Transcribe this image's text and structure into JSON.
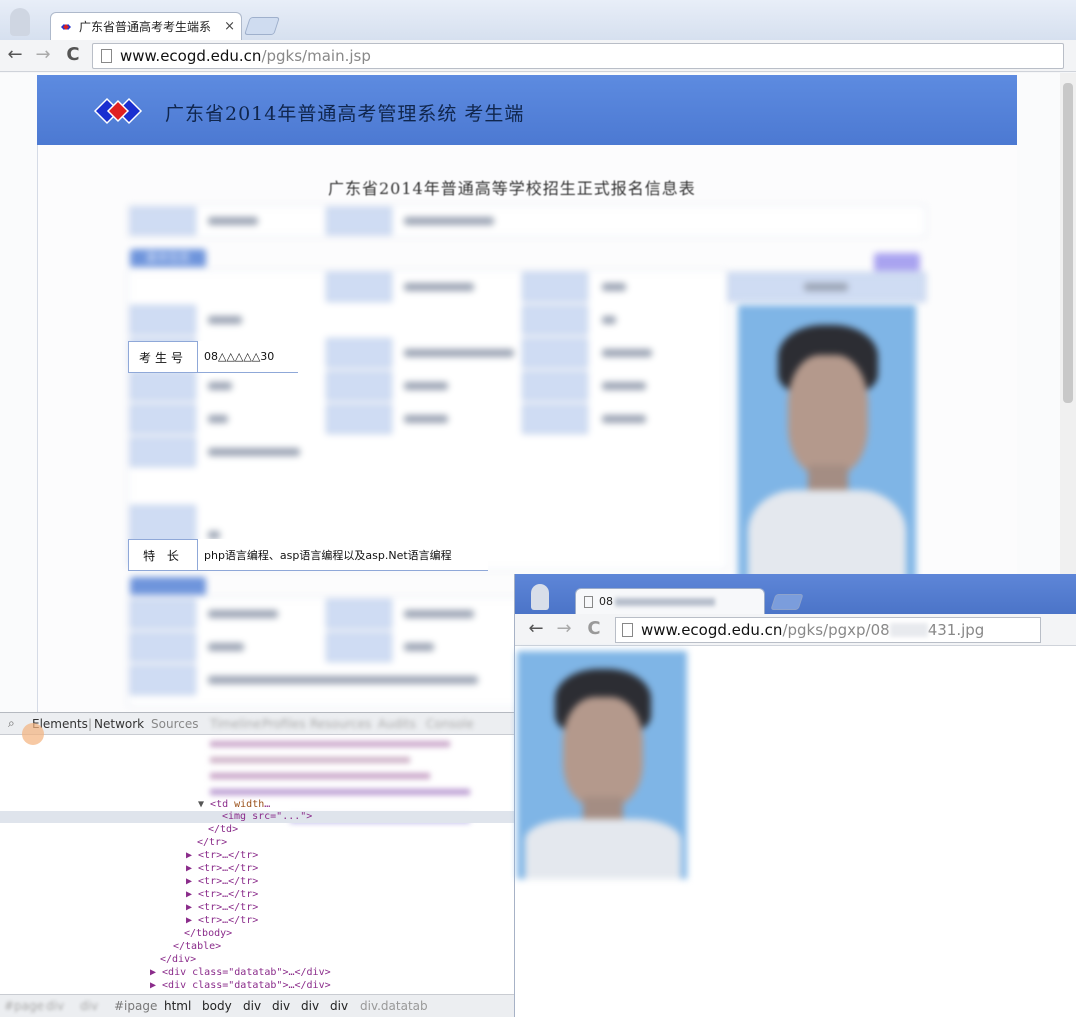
{
  "main_browser": {
    "tab_title": "广东省普通高考考生端系",
    "tab_close": "×",
    "nav": {
      "back": "←",
      "forward": "→",
      "reload": "C"
    },
    "url_host": "www.ecogd.edu.cn",
    "url_path": "/pgks/main.jsp"
  },
  "page": {
    "system_title": "广东省2014年普通高考管理系统  考生端",
    "form_title": "广东省2014年普通高等学校招生正式报名信息表",
    "section_basic": "基本信息",
    "exam_number_label": "考生号",
    "exam_number_value": "08△△△△△30",
    "specialty_label": "特    长",
    "specialty_value": "php语言编程、asp语言编程以及asp.Net语言编程",
    "accent_color": "#4c79d2"
  },
  "devtools": {
    "tabs": [
      "Elements",
      "Network",
      "Sources",
      "Timeline",
      "Profiles",
      "Resources",
      "Audits",
      "Console"
    ],
    "code_lines": [
      {
        "indent": 2,
        "text": "<img src=\"...\">"
      },
      {
        "indent": 1,
        "text": "</td>"
      },
      {
        "indent": 0,
        "text": "</tr>"
      },
      {
        "indent": 0,
        "text": "▶ <tr>…</tr>"
      },
      {
        "indent": 0,
        "text": "▶ <tr>…</tr>"
      },
      {
        "indent": 0,
        "text": "▶ <tr>…</tr>"
      },
      {
        "indent": 0,
        "text": "▶ <tr>…</tr>"
      },
      {
        "indent": 0,
        "text": "▶ <tr>…</tr>"
      },
      {
        "indent": 0,
        "text": "▶ <tr>…</tr>"
      },
      {
        "indent": -1,
        "text": "</tbody>"
      },
      {
        "indent": -2,
        "text": "</table>"
      },
      {
        "indent": -3,
        "text": "</div>"
      },
      {
        "indent": -4,
        "text": "▶ <div class=\"datatab\">…</div>"
      },
      {
        "indent": -4,
        "text": "▶ <div class=\"datatab\">…</div>"
      }
    ],
    "breadcrumbs": [
      "html",
      "body",
      "div",
      "div",
      "div",
      "div",
      "div.datatab"
    ],
    "breadcrumb_lead": [
      "#page",
      "div",
      "div",
      "#ipage"
    ]
  },
  "popup": {
    "tab_prefix": "08",
    "url_host": "www.ecogd.edu.cn",
    "url_path_prefix": "/pgks/pgxp/08",
    "url_path_suffix": "431.jpg"
  }
}
